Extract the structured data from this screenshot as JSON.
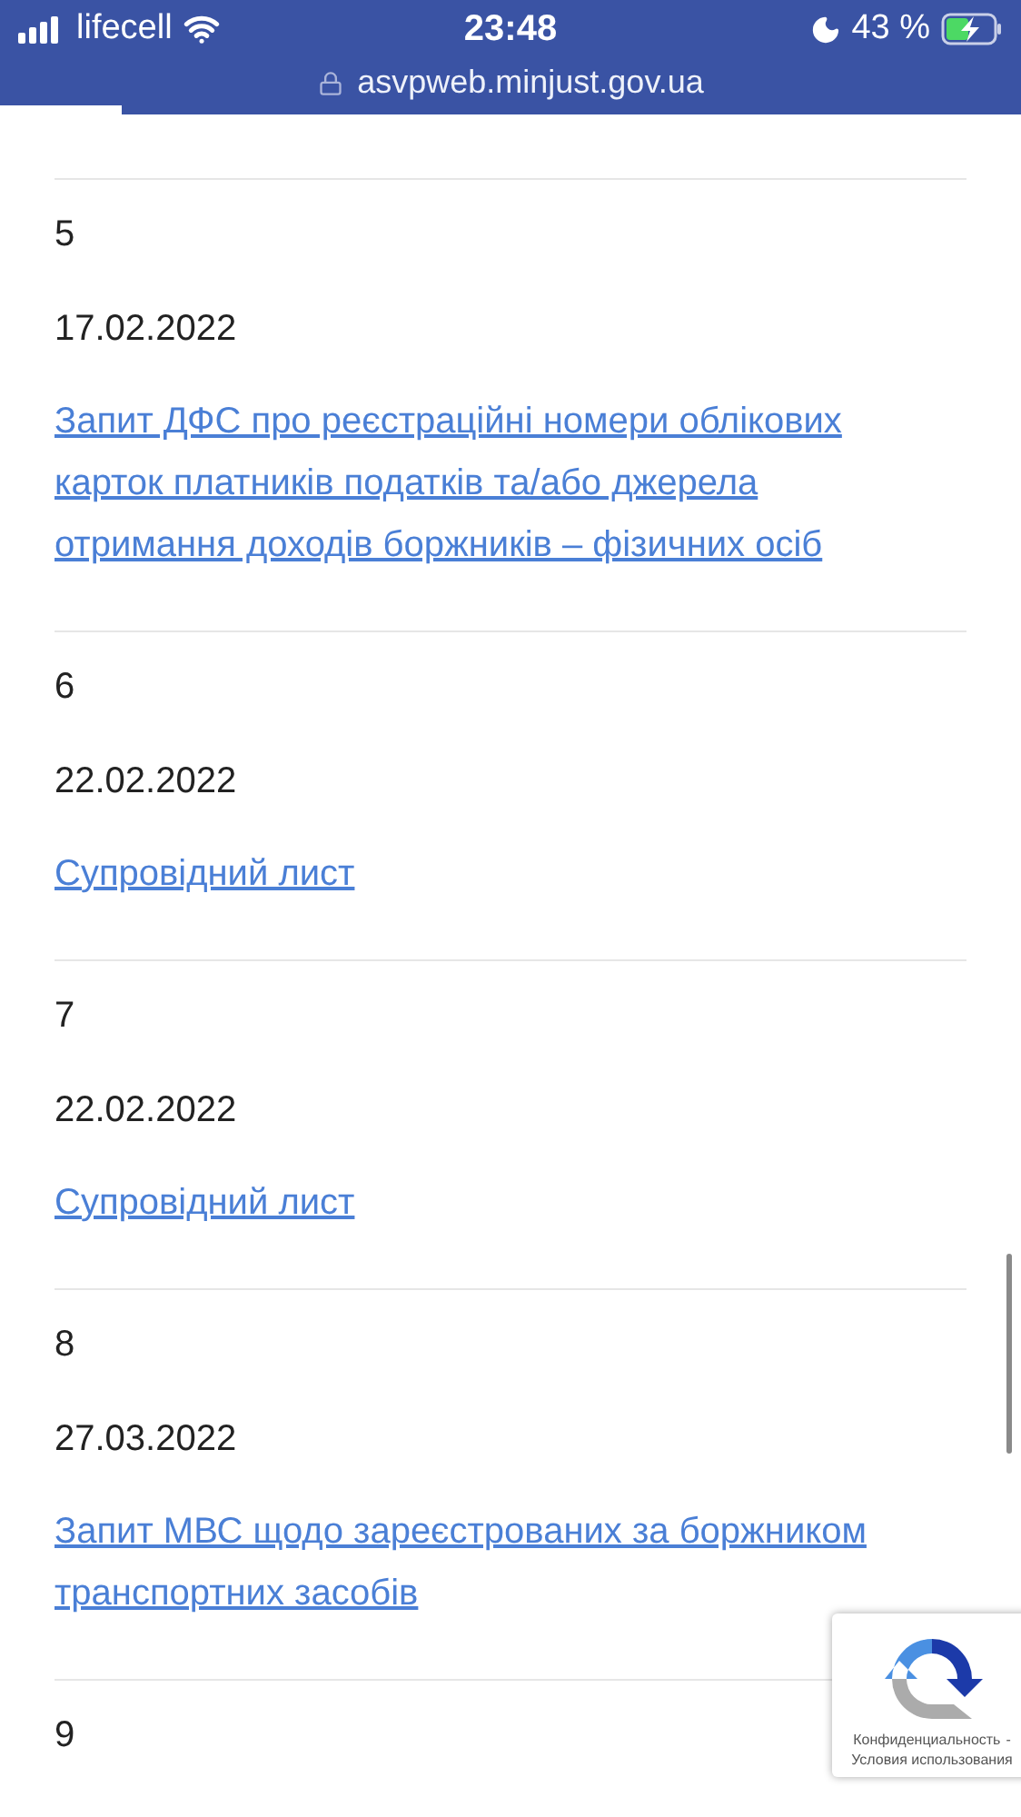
{
  "status_bar": {
    "carrier": "lifecell",
    "time": "23:48",
    "battery": "43 %"
  },
  "address_bar": {
    "url": "asvpweb.minjust.gov.ua"
  },
  "rows": [
    {
      "number": "5",
      "date": "17.02.2022",
      "link": "Запит ДФС про реєстраційні номери облікових карток платників податків та/або джерела отримання доходів боржників – фізичних осіб"
    },
    {
      "number": "6",
      "date": "22.02.2022",
      "link": "Супровідний лист"
    },
    {
      "number": "7",
      "date": "22.02.2022",
      "link": "Супровідний лист"
    },
    {
      "number": "8",
      "date": "27.03.2022",
      "link": "Запит МВС щодо зареєстрованих за боржником транспортних засобів"
    },
    {
      "number": "9"
    }
  ],
  "recaptcha": {
    "privacy": "Конфиденциальность",
    "separator": "-",
    "terms": "Условия использования"
  }
}
